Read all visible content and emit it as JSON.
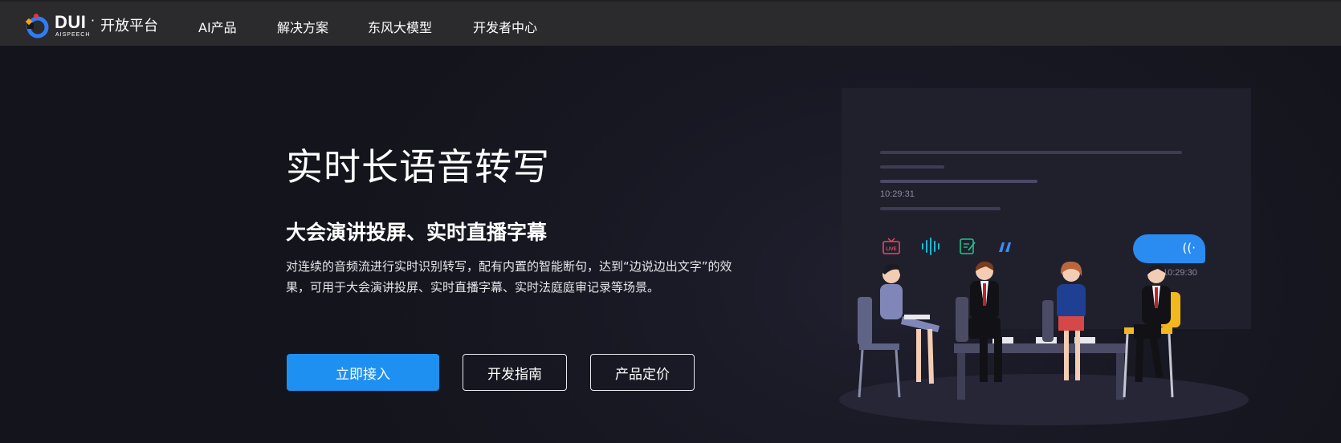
{
  "header": {
    "brand": "DUI",
    "brand_sub": "AISPEECH",
    "platform": "开放平台",
    "nav": [
      "AI产品",
      "解决方案",
      "东风大模型",
      "开发者中心"
    ]
  },
  "hero": {
    "title": "实时长语音转写",
    "subtitle": "大会演讲投屏、实时直播字幕",
    "description": "对连续的音频流进行实时识别转写，配有内置的智能断句，达到“边说边出文字”的效果，可用于大会演讲投屏、实时直播字幕、实时法庭庭审记录等场景。",
    "buttons": {
      "primary": "立即接入",
      "guide": "开发指南",
      "pricing": "产品定价"
    }
  },
  "illustration": {
    "timestamp_1": "10:29:31",
    "timestamp_2": "10:29:30",
    "live_badge": "LIVE",
    "icons": [
      "live-tv-icon",
      "sound-wave-icon",
      "notes-icon",
      "quote-icon",
      "voice-icon"
    ]
  },
  "colors": {
    "accent": "#1e90f2",
    "nav_bg": "#2b2b2e",
    "hero_bg": "#16161f",
    "live_icon": "#e24b5e",
    "wave_icon": "#22b6d6",
    "notes_icon": "#1ec28b",
    "quote_icon": "#3b8cf5"
  }
}
